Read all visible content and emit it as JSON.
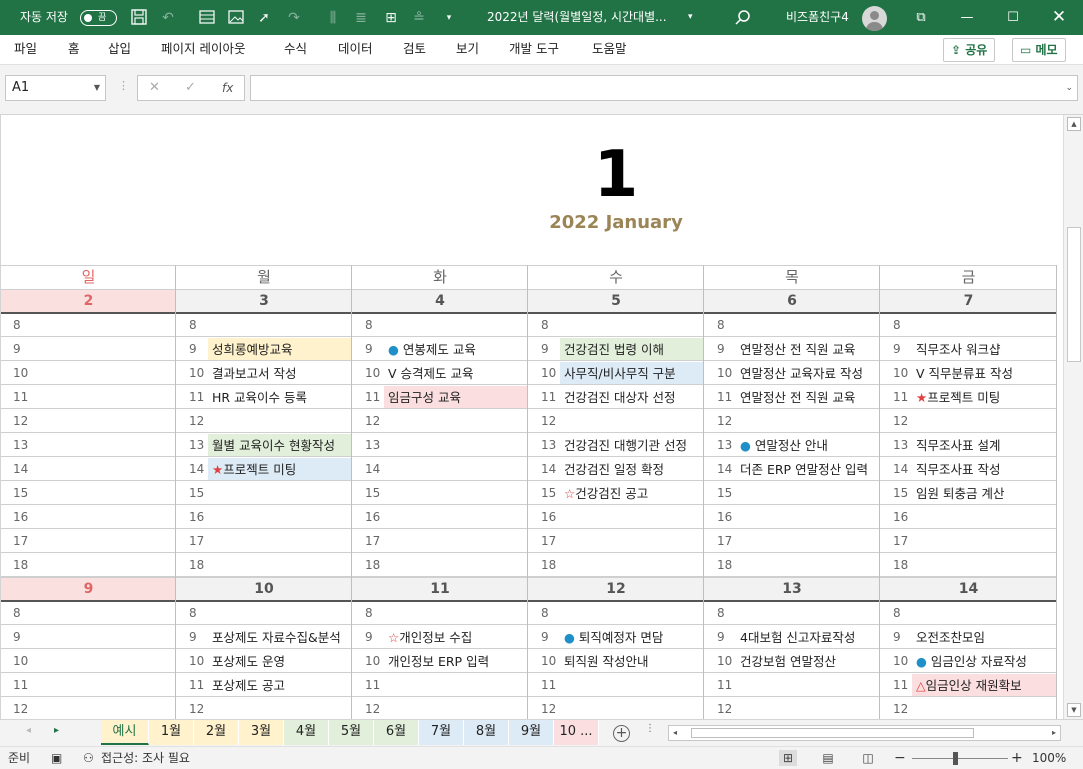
{
  "titlebar": {
    "autosave_label": "자동 저장",
    "autosave_state": "끔",
    "doc_title": "2022년 달력(월별일정, 시간대별...",
    "user_name": "비즈폼친구4",
    "icons": [
      "save-icon",
      "undo-icon",
      "redo-icon",
      "filter-icon",
      "image-icon",
      "pointer-icon",
      "align-icon",
      "grid-icon",
      "table-icon",
      "more-icon",
      "search-icon",
      "ribbon-display-icon",
      "minimize-icon",
      "maximize-icon",
      "close-icon"
    ]
  },
  "menu": {
    "items": [
      "파일",
      "홈",
      "삽입",
      "페이지 레이아웃",
      "수식",
      "데이터",
      "검토",
      "보기",
      "개발 도구",
      "도움말"
    ],
    "share": "공유",
    "memo": "메모"
  },
  "formula": {
    "namebox": "A1",
    "value": ""
  },
  "calendar": {
    "month_number": "1",
    "month_title": "2022 January",
    "day_names": [
      "일",
      "월",
      "화",
      "수",
      "목",
      "금"
    ],
    "hours": [
      "8",
      "9",
      "10",
      "11",
      "12",
      "13",
      "14",
      "15",
      "16",
      "17",
      "18"
    ],
    "weeks": [
      {
        "dates": [
          "2",
          "3",
          "4",
          "5",
          "6",
          "7"
        ],
        "events": [
          [],
          [
            {
              "hour": "9",
              "text": "성희롱예방교육",
              "color": "yellow"
            },
            {
              "hour": "10",
              "text": "결과보고서 작성"
            },
            {
              "hour": "11",
              "text": "HR 교육이수 등록"
            },
            {
              "hour": "13",
              "text": "월별 교육이수 현황작성",
              "color": "green"
            },
            {
              "hour": "14",
              "text": "★프로젝트 미팅",
              "color": "blue"
            }
          ],
          [
            {
              "hour": "9",
              "text": "● 연봉제도 교육"
            },
            {
              "hour": "10",
              "text": "V 승격제도 교육"
            },
            {
              "hour": "11",
              "text": "임금구성 교육",
              "color": "pink"
            }
          ],
          [
            {
              "hour": "9",
              "text": "건강검진 법령 이해",
              "color": "green"
            },
            {
              "hour": "10",
              "text": "사무직/비사무직 구분",
              "color": "blue"
            },
            {
              "hour": "11",
              "text": "건강검진 대상자 선정"
            },
            {
              "hour": "13",
              "text": "건강검진 대행기관 선정"
            },
            {
              "hour": "14",
              "text": "건강검진 일정 확정"
            },
            {
              "hour": "15",
              "text": "☆건강검진 공고"
            }
          ],
          [
            {
              "hour": "9",
              "text": "연말정산 전 직원 교육"
            },
            {
              "hour": "10",
              "text": "연말정산 교육자료 작성"
            },
            {
              "hour": "11",
              "text": "연말정산 전 직원 교육"
            },
            {
              "hour": "13",
              "text": "● 연말정산 안내"
            },
            {
              "hour": "14",
              "text": "더존 ERP 연말정산 입력"
            }
          ],
          [
            {
              "hour": "9",
              "text": "직무조사 워크샵"
            },
            {
              "hour": "10",
              "text": "V 직무분류표 작성"
            },
            {
              "hour": "11",
              "text": "★프로젝트 미팅"
            },
            {
              "hour": "13",
              "text": "직무조사표 설계"
            },
            {
              "hour": "14",
              "text": "직무조사표 작성"
            },
            {
              "hour": "15",
              "text": "임원 퇴충금 계산"
            }
          ]
        ]
      },
      {
        "dates": [
          "9",
          "10",
          "11",
          "12",
          "13",
          "14"
        ],
        "events": [
          [],
          [
            {
              "hour": "9",
              "text": "포상제도 자료수집&분석"
            },
            {
              "hour": "10",
              "text": "포상제도 운영"
            },
            {
              "hour": "11",
              "text": "포상제도 공고"
            }
          ],
          [
            {
              "hour": "9",
              "text": "☆개인정보 수집"
            },
            {
              "hour": "10",
              "text": "개인정보 ERP 입력"
            }
          ],
          [
            {
              "hour": "9",
              "text": "● 퇴직예정자 면담"
            },
            {
              "hour": "10",
              "text": "퇴직원 작성안내"
            }
          ],
          [
            {
              "hour": "9",
              "text": "4대보험 신고자료작성"
            },
            {
              "hour": "10",
              "text": "건강보험 연말정산"
            }
          ],
          [
            {
              "hour": "9",
              "text": "오전조찬모임"
            },
            {
              "hour": "10",
              "text": "● 임금인상 자료작성"
            },
            {
              "hour": "11",
              "text": "△임금인상 재원확보",
              "color": "pink"
            }
          ]
        ]
      }
    ]
  },
  "tabs": [
    {
      "label": "예시",
      "color": "#fff2cc"
    },
    {
      "label": "1월",
      "color": "#fff2cc"
    },
    {
      "label": "2월",
      "color": "#fff2cc"
    },
    {
      "label": "3월",
      "color": "#fff2cc"
    },
    {
      "label": "4월",
      "color": "#e2efda"
    },
    {
      "label": "5월",
      "color": "#e2efda"
    },
    {
      "label": "6월",
      "color": "#e2efda"
    },
    {
      "label": "7월",
      "color": "#ddebf7"
    },
    {
      "label": "8월",
      "color": "#ddebf7"
    },
    {
      "label": "9월",
      "color": "#ddebf7"
    },
    {
      "label": "10 ...",
      "color": "#fbdfe0"
    }
  ],
  "status": {
    "ready": "준비",
    "accessibility": "접근성: 조사 필요",
    "zoom": "100%"
  },
  "colors": {
    "excel_green": "#217346",
    "sunday_red": "#e06666",
    "month_title": "#9b8456",
    "yellow": "#fff2cc",
    "green": "#e2efda",
    "blue": "#ddebf7",
    "pink": "#fbdfe0",
    "bullet_blue": "#1f8fc7",
    "star_red": "#e04040"
  }
}
